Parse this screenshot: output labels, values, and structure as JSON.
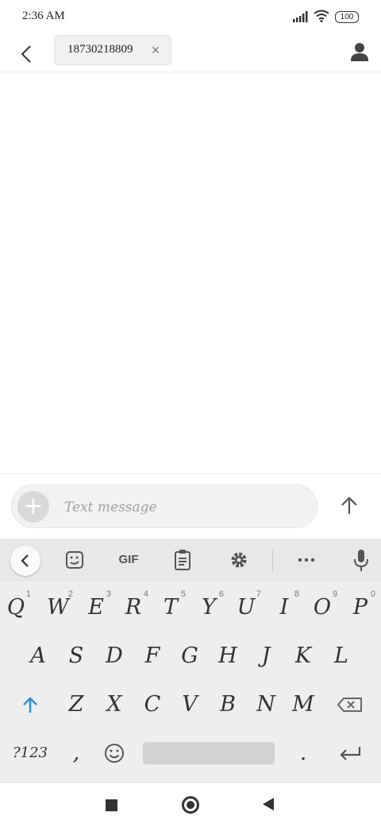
{
  "status_bar": {
    "time": "2:36 AM",
    "battery": "100",
    "icons": [
      "signal-icon",
      "wifi-icon",
      "battery-icon"
    ]
  },
  "header": {
    "recipient": "18730218809",
    "chip_close": "×",
    "icons": [
      "back-arrow-icon",
      "close-icon",
      "contact-person-icon"
    ]
  },
  "compose": {
    "add_symbol": "+",
    "placeholder": "Text message",
    "value": "",
    "icons": [
      "plus-icon",
      "send-arrow-up-icon"
    ]
  },
  "keyboard": {
    "toolbar": {
      "gif_label": "GIF",
      "icons": [
        "chevron-left-icon",
        "sticker-icon",
        "gif-icon",
        "clipboard-icon",
        "gear-icon",
        "more-dots-icon",
        "microphone-icon"
      ]
    },
    "row1": [
      {
        "label": "Q",
        "hint": "1"
      },
      {
        "label": "W",
        "hint": "2"
      },
      {
        "label": "E",
        "hint": "3"
      },
      {
        "label": "R",
        "hint": "4"
      },
      {
        "label": "T",
        "hint": "5"
      },
      {
        "label": "Y",
        "hint": "6"
      },
      {
        "label": "U",
        "hint": "7"
      },
      {
        "label": "I",
        "hint": "8"
      },
      {
        "label": "O",
        "hint": "9"
      },
      {
        "label": "P",
        "hint": "0"
      }
    ],
    "row2": [
      "A",
      "S",
      "D",
      "F",
      "G",
      "H",
      "J",
      "K",
      "L"
    ],
    "row3": [
      "Z",
      "X",
      "C",
      "V",
      "B",
      "N",
      "M"
    ],
    "bottom": {
      "symbols": "?123",
      "comma": ",",
      "period": "."
    },
    "icons": [
      "shift-arrow-icon",
      "backspace-icon",
      "emoji-icon",
      "enter-icon"
    ],
    "colors": {
      "shift": "#2b8fe0",
      "background": "#eeeeee"
    }
  },
  "nav_bar": {
    "icons": [
      "recents-square-icon",
      "home-circle-icon",
      "back-triangle-icon"
    ]
  }
}
